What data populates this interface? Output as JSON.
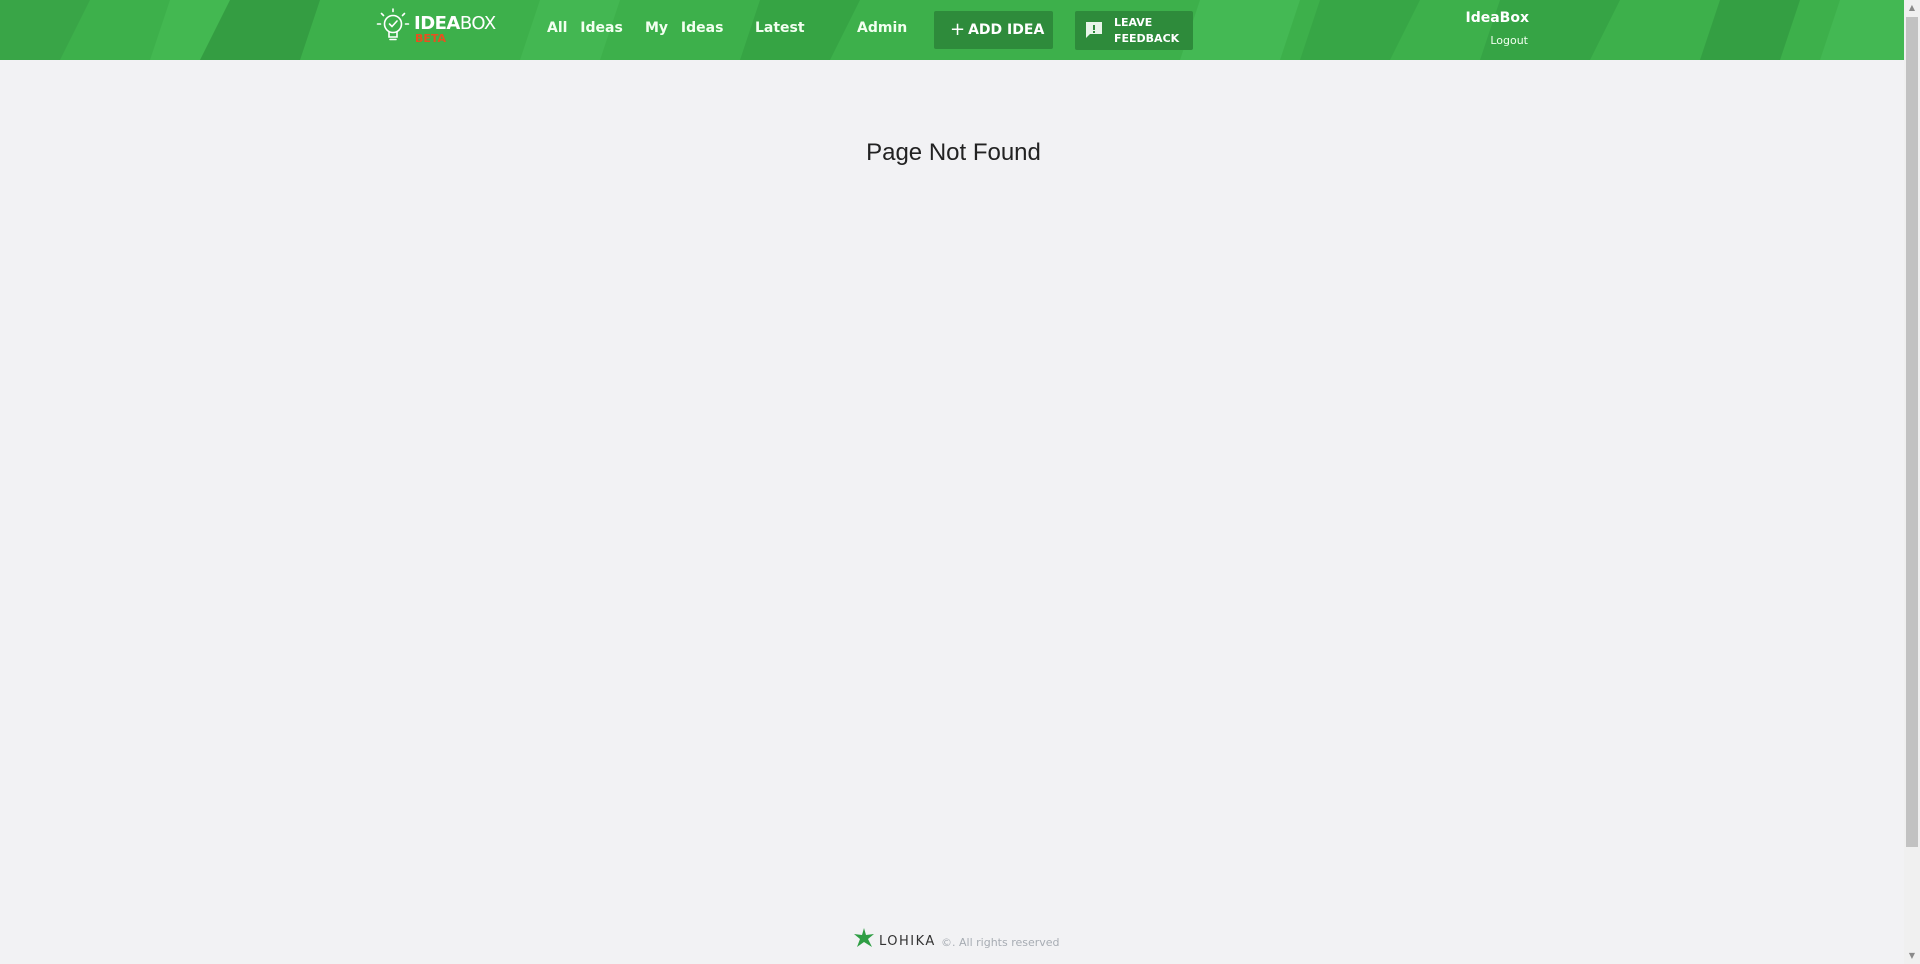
{
  "header": {
    "logo": {
      "word_bold": "IDEA",
      "word_light": "BOX",
      "badge": "BETA"
    },
    "nav": [
      {
        "label": "All Ideas"
      },
      {
        "label": "My Ideas"
      },
      {
        "label": "Latest"
      },
      {
        "label": "Admin"
      }
    ],
    "add_idea": {
      "icon": "plus-icon",
      "label": "ADD IDEA"
    },
    "feedback": {
      "icon": "feedback-icon",
      "line1": "LEAVE",
      "line2": "FEEDBACK"
    },
    "user": {
      "name": "IdeaBox",
      "logout_label": "Logout"
    }
  },
  "main": {
    "title": "Page Not Found"
  },
  "footer": {
    "brand": "LOHIKA",
    "rights": "©. All rights reserved"
  },
  "colors": {
    "header_green": "#3db04b",
    "button_green": "#2e8b3b",
    "beta_orange": "#e8501f",
    "page_bg": "#f2f2f4"
  }
}
